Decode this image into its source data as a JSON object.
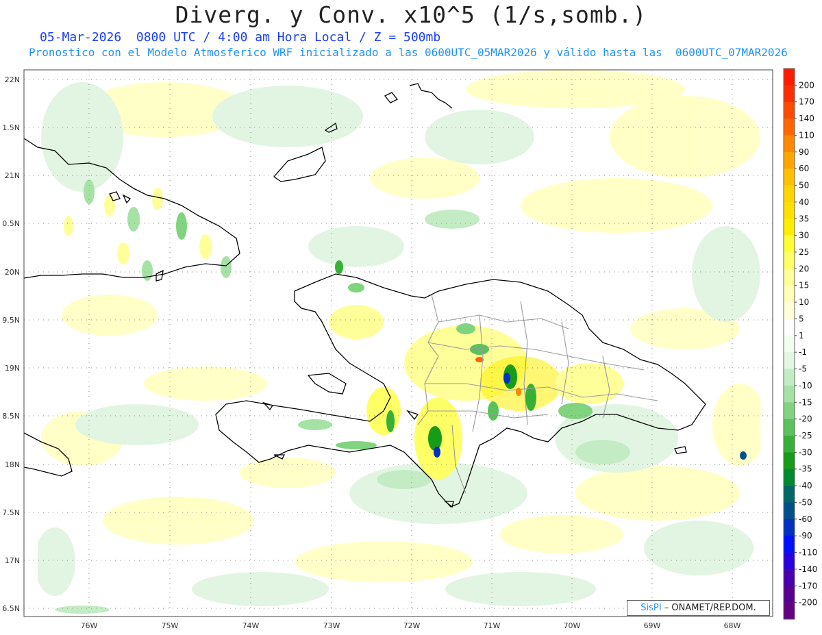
{
  "header": {
    "title": "Diverg. y Conv. x10^5 (1/s,somb.)",
    "subtitle_1": "05-Mar-2026  0800 UTC / 4:00 am Hora Local / Z = 500mb",
    "subtitle_2": "Pronostico con el Modelo Atmosferico WRF inicializado a las 0600UTC_05MAR2026 y válido hasta las  0600UTC_07MAR2026"
  },
  "map": {
    "lat_labels": [
      "22N",
      "1.5N",
      "21N",
      "0.5N",
      "20N",
      "9.5N",
      "19N",
      "8.5N",
      "18N",
      "7.5N",
      "17N",
      "6.5N"
    ],
    "lon_labels": [
      "76W",
      "75W",
      "74W",
      "73W",
      "72W",
      "71W",
      "70W",
      "69W",
      "68W"
    ]
  },
  "colorbar": {
    "labels": [
      "200",
      "170",
      "140",
      "110",
      "90",
      "60",
      "50",
      "40",
      "35",
      "30",
      "25",
      "20",
      "15",
      "10",
      "5",
      "1",
      "-1",
      "-5",
      "-10",
      "-15",
      "-20",
      "-25",
      "-30",
      "-35",
      "-40",
      "-50",
      "-60",
      "-90",
      "-110",
      "-140",
      "-170",
      "-200"
    ],
    "colors": [
      "#ff1a00",
      "#ff2e00",
      "#ff4a00",
      "#ff6600",
      "#ff8800",
      "#ffa500",
      "#ffc000",
      "#ffd400",
      "#ffe000",
      "#ffee00",
      "#ffff33",
      "#ffff66",
      "#ffff99",
      "#ffffb8",
      "#ffffd8",
      "#ffffff",
      "#f0fff0",
      "#e4f6e4",
      "#c4ecc4",
      "#a6e2a6",
      "#80d480",
      "#5ac25a",
      "#38b038",
      "#169c16",
      "#008a30",
      "#006868",
      "#00508e",
      "#0030c4",
      "#0010ff",
      "#2a00e0",
      "#4a00b0",
      "#5a0090",
      "#650080"
    ]
  },
  "credit": {
    "brand": "SisPI",
    "text": " – ONAMET/REP.DOM."
  }
}
